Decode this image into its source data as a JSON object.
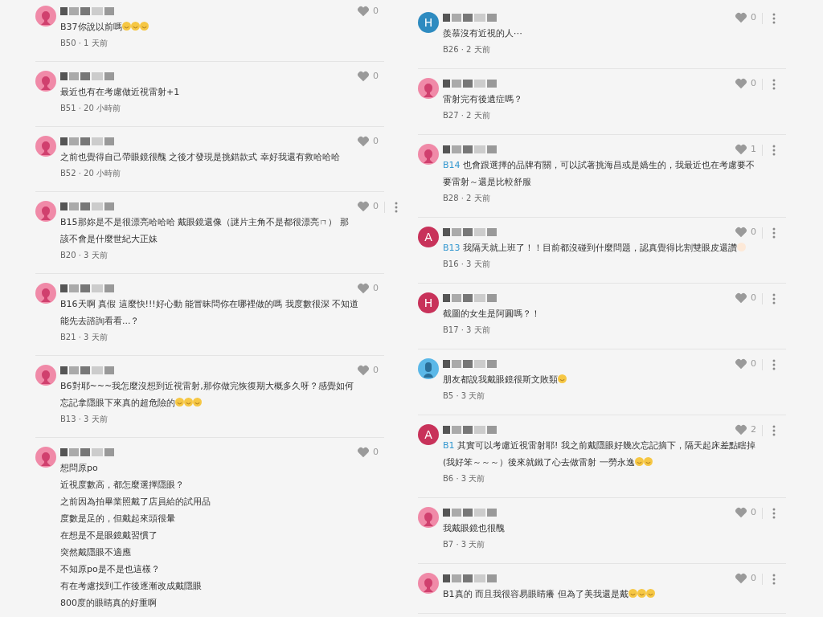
{
  "columns": [
    {
      "comments": [
        {
          "avatar": {
            "kind": "female"
          },
          "lines": [
            "B37你說以前嗎"
          ],
          "emojis": [
            {
              "kind": "smile"
            },
            {
              "kind": "smile"
            },
            {
              "kind": "smile"
            }
          ],
          "meta": "B50 · 1 天前",
          "likes": "0",
          "menu": false
        },
        {
          "avatar": {
            "kind": "female"
          },
          "lines": [
            "最近也有在考慮做近視雷射+1"
          ],
          "meta": "B51 · 20 小時前",
          "likes": "0",
          "menu": false
        },
        {
          "avatar": {
            "kind": "female"
          },
          "lines": [
            "之前也覺得自己帶眼鏡很醜 之後才發現是挑錯款式 幸好我還有救哈哈哈"
          ],
          "meta": "B52 · 20 小時前",
          "likes": "0",
          "menu": false
        },
        {
          "avatar": {
            "kind": "female"
          },
          "lines": [
            "B15那妳是不是很漂亮哈哈哈 戴眼鏡還像（謎片主角不是都很漂亮ㄇ） 那",
            "該不會是什麼世紀大正妹"
          ],
          "meta": "B20 · 3 天前",
          "likes": "0",
          "menu": true
        },
        {
          "avatar": {
            "kind": "female"
          },
          "lines": [
            "B16天啊 真假 這麼快!!!好心動 能冒昧問你在哪裡做的嗎 我度數很深 不知道",
            "能先去諮詢看看...？"
          ],
          "meta": "B21 · 3 天前",
          "likes": "0",
          "menu": false
        },
        {
          "avatar": {
            "kind": "female"
          },
          "lines": [
            "B6對耶~~~我怎麼沒想到近視雷射,那你做完恢復期大概多久呀？感覺如何",
            "忘記拿隱眼下來真的超危險的"
          ],
          "emojis": [
            {
              "kind": "smile"
            },
            {
              "kind": "smile"
            },
            {
              "kind": "smile"
            }
          ],
          "meta": "B13 · 3 天前",
          "likes": "0",
          "menu": false
        },
        {
          "avatar": {
            "kind": "female"
          },
          "lines": [
            "想問原po",
            "近視度數高，都怎麼選擇隱眼？",
            "之前因為拍畢業照戴了店員給的試用品",
            "度數是足的，但戴起來頭很暈",
            "在想是不是眼鏡戴習慣了",
            "突然戴隱眼不適應",
            "不知原po是不是也這樣？",
            "有在考慮找到工作後逐漸改成戴隱眼",
            "800度的眼睛真的好重啊"
          ],
          "likes": "0",
          "menu": false
        }
      ]
    },
    {
      "comments": [
        {
          "avatar": {
            "kind": "letter",
            "letter": "H",
            "color": "#2e8bc0"
          },
          "lines": [
            "羨慕沒有近視的人⋯"
          ],
          "meta": "B26 · 2 天前",
          "likes": "0",
          "menu": true
        },
        {
          "avatar": {
            "kind": "female"
          },
          "lines": [
            "雷射完有後遺症嗎？"
          ],
          "meta": "B27 · 2 天前",
          "likes": "0",
          "menu": true
        },
        {
          "avatar": {
            "kind": "female"
          },
          "reply_to": "B14",
          "lines": [
            "也會跟選擇的品牌有關，可以試著挑海昌或是嬌生的，我最近也在考慮要不",
            "要雷射～還是比較舒服"
          ],
          "meta": "B28 · 2 天前",
          "likes": "1",
          "menu": true
        },
        {
          "avatar": {
            "kind": "letter",
            "letter": "A",
            "color": "#c8325a"
          },
          "reply_to": "B13",
          "lines": [
            "我隔天就上班了！！目前都沒碰到什麼問題，認真覺得比割雙眼皮還讚"
          ],
          "emojis": [
            {
              "kind": "hands"
            }
          ],
          "meta": "B16 · 3 天前",
          "likes": "0",
          "menu": true
        },
        {
          "avatar": {
            "kind": "letter",
            "letter": "H",
            "color": "#c8325a"
          },
          "lines": [
            "截圖的女生是阿圓嗎？！"
          ],
          "meta": "B17 · 3 天前",
          "likes": "0",
          "menu": true
        },
        {
          "avatar": {
            "kind": "male"
          },
          "lines": [
            "朋友都說我戴眼鏡很斯文敗類"
          ],
          "emojis": [
            {
              "kind": "smile"
            }
          ],
          "meta": "B5 · 3 天前",
          "likes": "0",
          "menu": true
        },
        {
          "avatar": {
            "kind": "letter",
            "letter": "A",
            "color": "#c8325a"
          },
          "reply_to": "B1",
          "lines": [
            "其實可以考慮近視雷射耶! 我之前戴隱眼好幾次忘記摘下，隔天起床差點瞎掉",
            "(我好笨～～～）後來就鐵了心去做雷射 一勞永逸"
          ],
          "emojis": [
            {
              "kind": "smile"
            },
            {
              "kind": "smile"
            }
          ],
          "meta": "B6 · 3 天前",
          "likes": "2",
          "menu": true
        },
        {
          "avatar": {
            "kind": "female"
          },
          "lines": [
            "我戴眼鏡也很醜"
          ],
          "meta": "B7 · 3 天前",
          "likes": "0",
          "menu": true
        },
        {
          "avatar": {
            "kind": "female"
          },
          "lines": [
            "B1真的 而且我很容易眼睛癢 但為了美我還是戴"
          ],
          "emojis": [
            {
              "kind": "smile"
            },
            {
              "kind": "smile"
            },
            {
              "kind": "smile"
            }
          ],
          "likes": "0",
          "menu": true
        }
      ]
    }
  ]
}
